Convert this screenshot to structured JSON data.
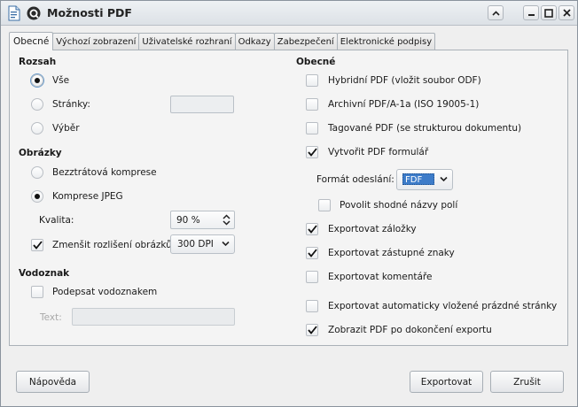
{
  "window": {
    "title": "Možnosti PDF"
  },
  "tabs": [
    {
      "label": "Obecné",
      "active": true
    },
    {
      "label": "Výchozí zobrazení",
      "active": false
    },
    {
      "label": "Uživatelské rozhraní",
      "active": false
    },
    {
      "label": "Odkazy",
      "active": false
    },
    {
      "label": "Zabezpečení",
      "active": false
    },
    {
      "label": "Elektronické podpisy",
      "active": false
    }
  ],
  "left": {
    "range": {
      "title": "Rozsah",
      "all": {
        "label": "Vše",
        "selected": true
      },
      "pages": {
        "label": "Stránky:",
        "selected": false,
        "value": ""
      },
      "selection": {
        "label": "Výběr",
        "selected": false
      }
    },
    "images": {
      "title": "Obrázky",
      "lossless": {
        "label": "Bezztrátová komprese",
        "selected": false
      },
      "jpeg": {
        "label": "Komprese JPEG",
        "selected": true
      },
      "quality_label": "Kvalita:",
      "quality_value": "90 %",
      "reduce": {
        "label": "Zmenšit rozlišení obrázků",
        "checked": true
      },
      "dpi_value": "300 DPI"
    },
    "watermark": {
      "title": "Vodoznak",
      "sign": {
        "label": "Podepsat vodoznakem",
        "checked": false
      },
      "text_label": "Text:",
      "text_value": ""
    }
  },
  "right": {
    "title": "Obecné",
    "hybrid": {
      "label": "Hybridní PDF (vložit soubor ODF)",
      "checked": false
    },
    "archive": {
      "label": "Archivní PDF/A-1a (ISO 19005-1)",
      "checked": false
    },
    "tagged": {
      "label": "Tagované PDF (se strukturou dokumentu)",
      "checked": false
    },
    "form": {
      "label": "Vytvořit PDF formulář",
      "checked": true
    },
    "submit_format_label": "Formát odeslání:",
    "submit_format_value": "FDF",
    "duplicate": {
      "label": "Povolit shodné názvy polí",
      "checked": false
    },
    "bookmarks": {
      "label": "Exportovat záložky",
      "checked": true
    },
    "placeholders": {
      "label": "Exportovat zástupné znaky",
      "checked": true
    },
    "comments": {
      "label": "Exportovat komentáře",
      "checked": false
    },
    "blank_pages": {
      "label": "Exportovat automaticky vložené prázdné stránky",
      "checked": false
    },
    "show_pdf": {
      "label": "Zobrazit PDF po dokončení exportu",
      "checked": true
    }
  },
  "buttons": {
    "help": "Nápověda",
    "export": "Exportovat",
    "cancel": "Zrušit"
  },
  "colors": {
    "selection": "#3d7cc9",
    "window_bg": "#efefef"
  }
}
